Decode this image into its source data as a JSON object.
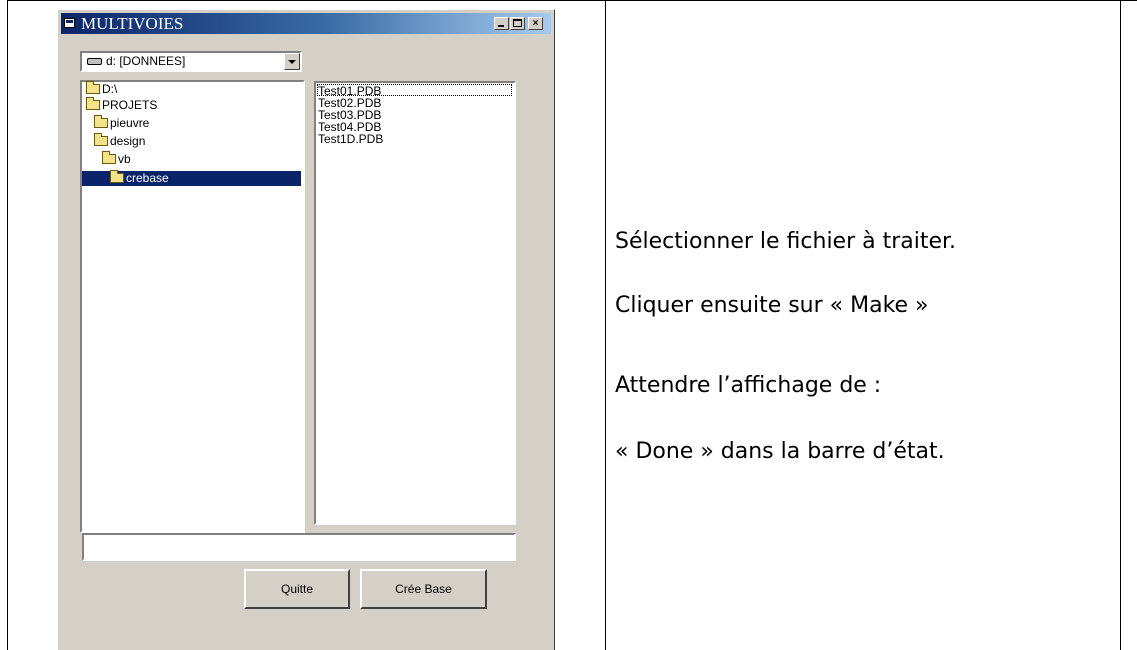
{
  "window": {
    "title": "MULTIVOIES",
    "controls": {
      "minimize": "minimize",
      "maximize": "maximize",
      "close": "×"
    }
  },
  "drive_combo": {
    "value": "d: [DONNEES]"
  },
  "folders": [
    {
      "label": "D:\\",
      "indent": 0,
      "selected": false
    },
    {
      "label": "PROJETS",
      "indent": 0,
      "selected": false
    },
    {
      "label": "pieuvre",
      "indent": 1,
      "selected": false
    },
    {
      "label": "design",
      "indent": 1,
      "selected": false
    },
    {
      "label": "vb",
      "indent": 2,
      "selected": false
    },
    {
      "label": "crebase",
      "indent": 3,
      "selected": true
    }
  ],
  "files": [
    "Test01.PDB",
    "Test02.PDB",
    "Test03.PDB",
    "Test04.PDB",
    "Test1D.PDB"
  ],
  "status_value": "",
  "buttons": {
    "quit": "Quitte",
    "create_base": "Crée Base"
  },
  "instructions": [
    "Sélectionner le fichier à traiter.",
    "Cliquer ensuite sur « Make »",
    "Attendre l’affichage de :",
    "« Done » dans la barre d’état."
  ],
  "colors": {
    "window_bg": "#d4d0c8",
    "titlebar_start": "#0a246a",
    "titlebar_end": "#a6caf0",
    "selection": "#0a246a"
  }
}
